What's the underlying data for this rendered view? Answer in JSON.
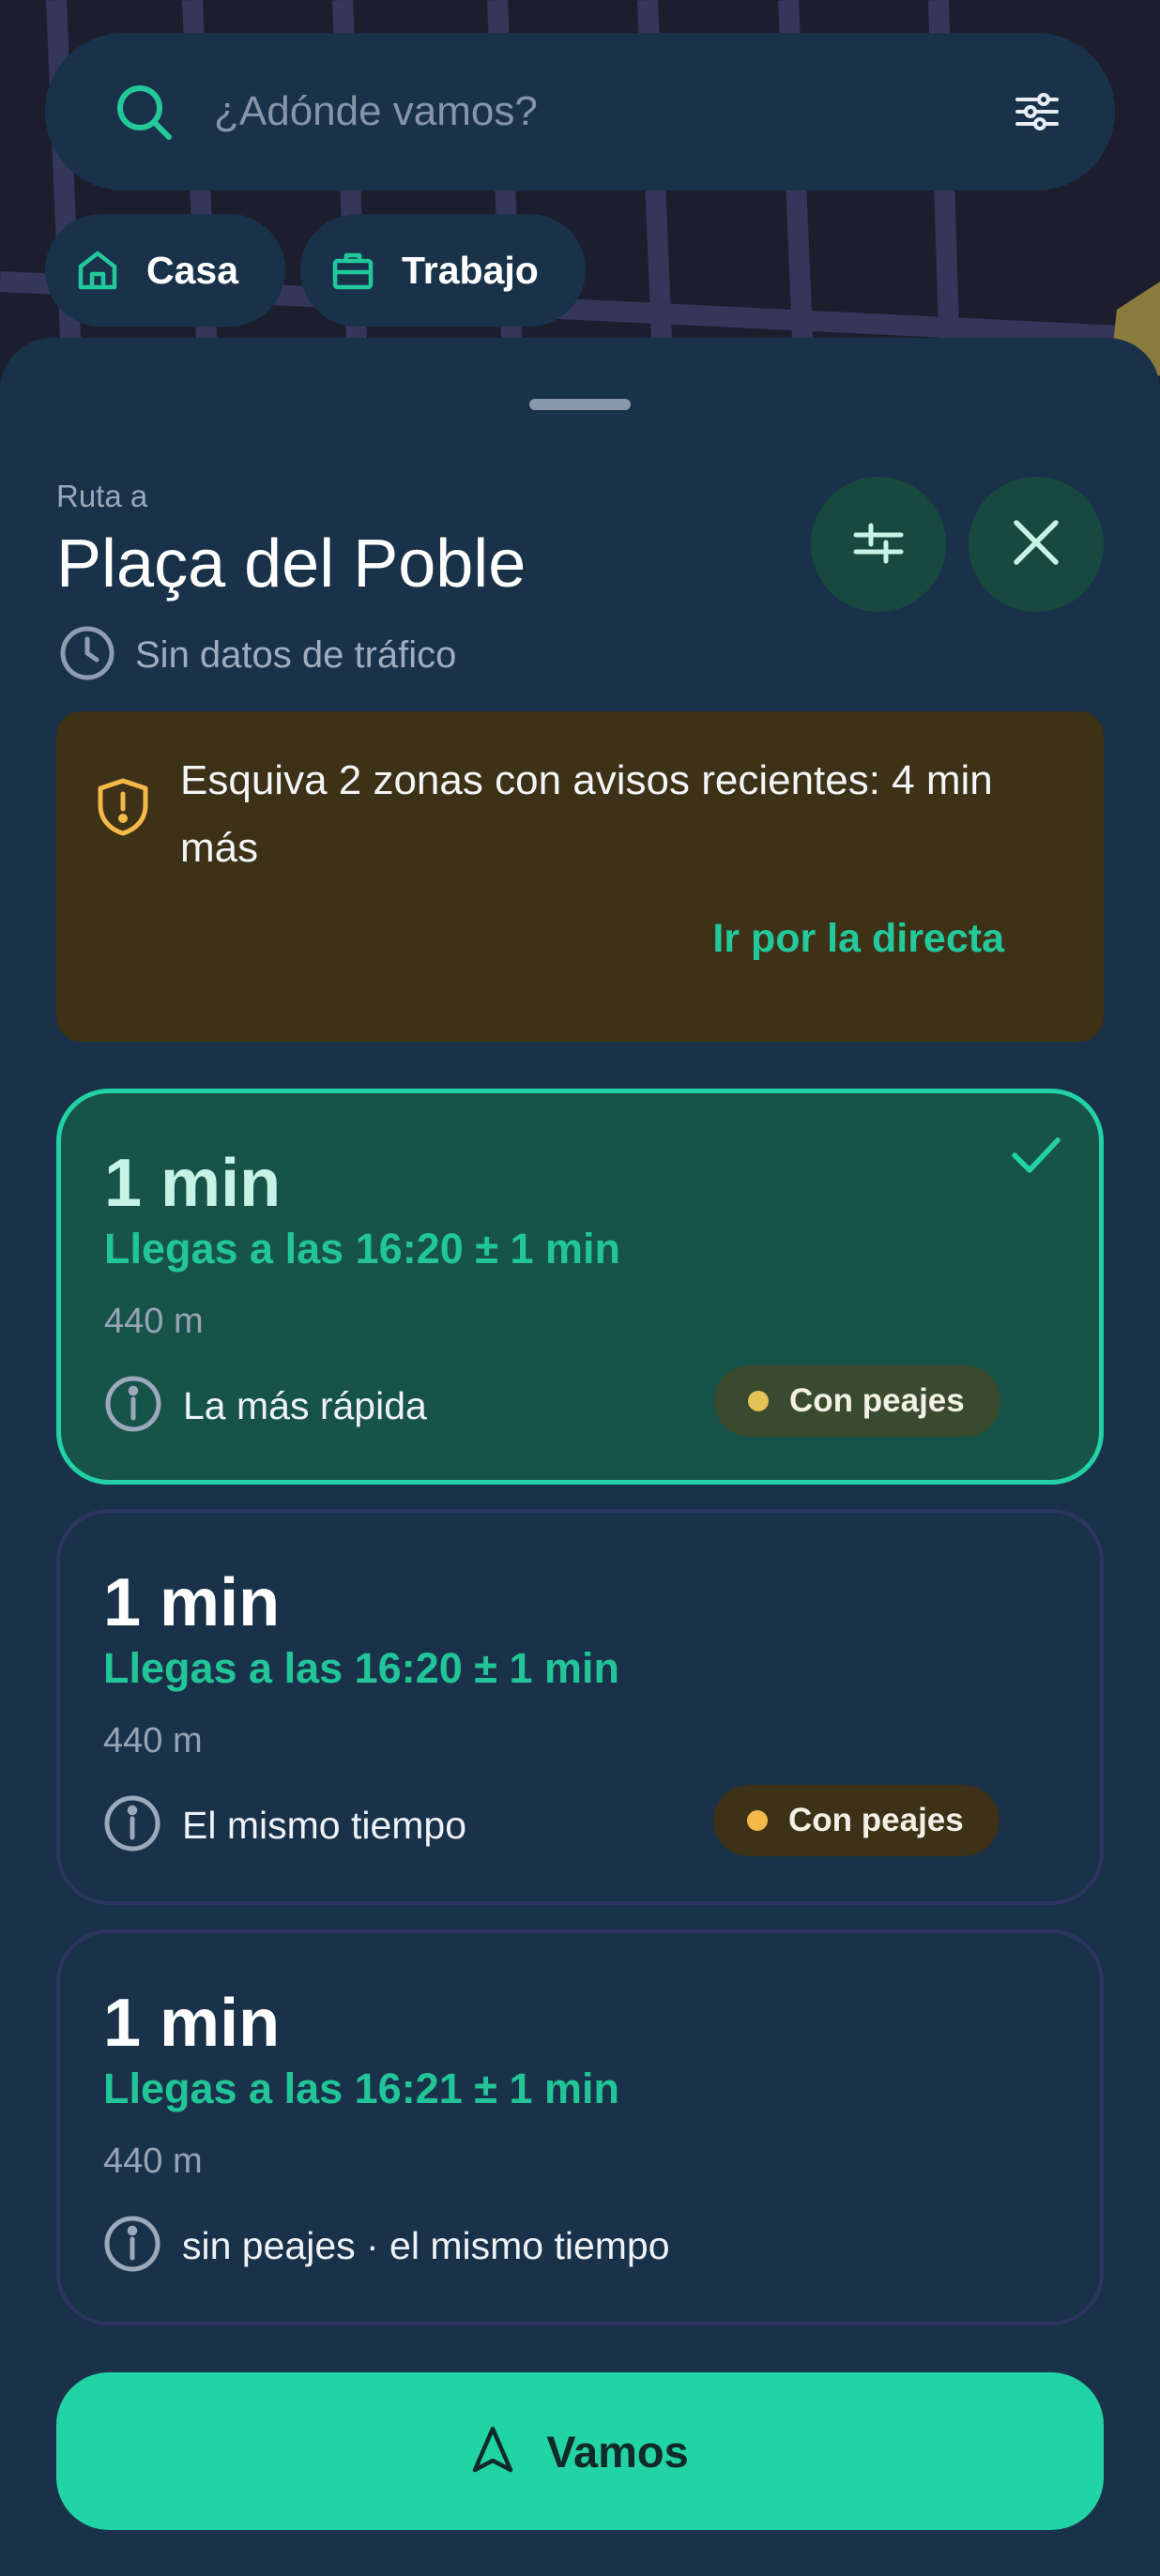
{
  "search": {
    "placeholder": "¿Adónde vamos?"
  },
  "shortcuts": [
    {
      "label": "Casa",
      "icon": "home-icon"
    },
    {
      "label": "Trabajo",
      "icon": "briefcase-icon"
    }
  ],
  "sheet": {
    "route_prefix": "Ruta a",
    "destination": "Plaça del Poble",
    "traffic_status": "Sin datos de tráfico"
  },
  "warning": {
    "message": "Esquiva 2 zonas con avisos recientes: 4 min más",
    "action": "Ir por la directa"
  },
  "routes": [
    {
      "duration": "1 min",
      "eta": "Llegas a las 16:20 ± 1 min",
      "distance": "440 m",
      "note": "La más rápida",
      "badge": "Con peajes",
      "selected": true
    },
    {
      "duration": "1 min",
      "eta": "Llegas a las 16:20 ± 1 min",
      "distance": "440 m",
      "note": "El mismo tiempo",
      "badge": "Con peajes",
      "selected": false
    },
    {
      "duration": "1 min",
      "eta": "Llegas a las 16:21 ± 1 min",
      "distance": "440 m",
      "note": "sin peajes · el mismo tiempo",
      "badge": "",
      "selected": false
    }
  ],
  "go_button": {
    "label": "Vamos"
  },
  "colors": {
    "accent": "#22d4a5",
    "sheet": "#1a3249",
    "warning_bg": "#3d3117",
    "toll_dot": "#f5b94a"
  }
}
